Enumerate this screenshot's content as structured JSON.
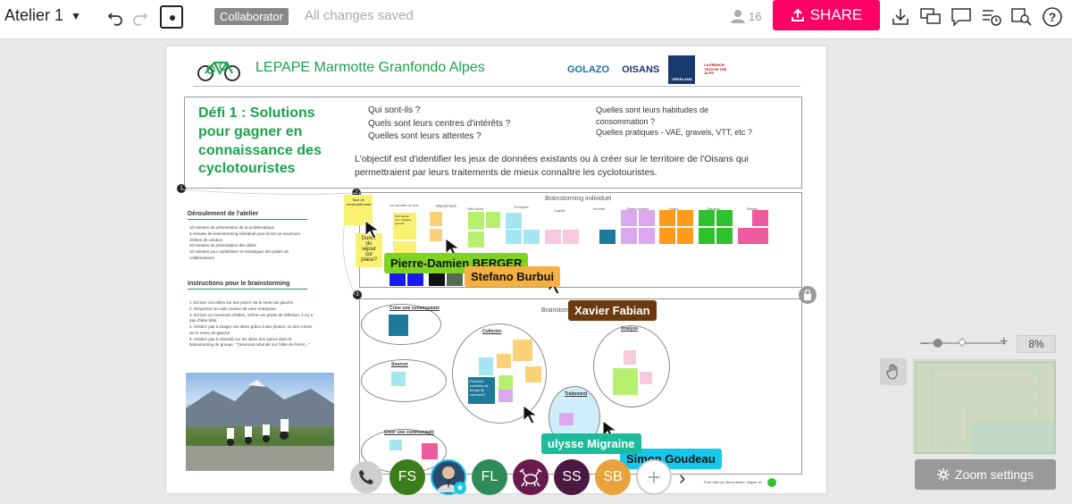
{
  "toolbar": {
    "board_title": "Atelier 1",
    "role_badge": "Collaborator",
    "save_status": "All changes saved",
    "participant_count": "16",
    "share_label": "SHARE",
    "share_color": "#ff0066"
  },
  "board": {
    "header_title": "LEPAPE Marmotte Granfondo Alpes",
    "logos": [
      "GOLAZO",
      "OISANS",
      "OBERLAND",
      "La FRENCH TECH IN THE ALPS"
    ],
    "defi": {
      "title": "Défi 1 : Solutions pour gagner en connaissance des cyclotouristes",
      "questions_left": [
        "Qui sont-ils ?",
        "Quels sont leurs centres d'intérêts ?",
        "Quelles sont leurs attentes ?"
      ],
      "questions_right": [
        "Quelles sont leurs habitudes de consommation ?",
        "Quelles pratiques - VAE, gravels, VTT, etc ?"
      ],
      "objective": "L'objectif est d'identifier les jeux de données existants ou à créer sur le territoire de l'Oisans qui permettraient par leurs traitements de mieux connaître les cyclotouristes."
    },
    "left_panel": {
      "deroulement_title": "Déroulement de l'atelier",
      "deroulement_lines": [
        "10 minutes de présentation de la problématique",
        "3 minutes de brainstorming individuel pour écrire un maximum d'idées de solution",
        "20 minutes de présentation des idées",
        "10 minutes pour synthétiser et investiguer des pistes de collaborations"
      ],
      "instructions_title": "Instructions pour le brainstorming",
      "instructions_lines": [
        "1. Ecrivez vos idées sur des post-it via le menu de gauche",
        "2. Respectez le code couleur de votre entreprise",
        "3. Ecrivez un maximum d'idées, même vos pistes de réflexion, il n'y a pas d'idée bête",
        "4. Hésitez pas à imager vos idées grâce à des photos, ou des icônes via le menu de gauche",
        "5. Hésitez pas à rebondir sur les idées des autres dans le brainstorming de groupe : \"j'aimerais rebondir sur l'idée de Pierre...\""
      ]
    },
    "steps": [
      "1",
      "2",
      "3"
    ],
    "brainstorm_individual_title": "Brainstorming individuel",
    "brainstorm_group_title": "Brainstorming",
    "column_labels": [
      "Les données de tous",
      "Marvel lock",
      "Vitis Epona",
      "Tunnpark",
      "Cognitiv",
      "Mountek",
      "Oisans tourisme",
      "Golazo",
      "Oberland",
      "Wingtip"
    ],
    "sticky_texts": {
      "taux": "Taux de renouvellement",
      "duree": "Durée du séjour sur place?",
      "tarif": "Tarif spécial pour cyclistes groupés",
      "pendant": "Pendant combien de temps ils viennent?"
    },
    "ellipses": {
      "creer1": "Créer une communauté",
      "sourcer": "Sourcer",
      "creer2": "Créer une communauté",
      "collecter": "Collecter",
      "analyse": "Analyse",
      "traitement": "Traitement"
    },
    "footer_note": "Pour aller au 3ème atelier, cliquer ici"
  },
  "cursors": [
    {
      "name": "Pierre-Damien BERGER",
      "color": "#7ed321"
    },
    {
      "name": "Stefano Burbui",
      "color": "#f5b041"
    },
    {
      "name": "Xavier Fabian",
      "color": "#6b3a10"
    },
    {
      "name": "ulysse Migraine",
      "color": "#1abc9c"
    },
    {
      "name": "Simon Goudeau",
      "color": "#15c8ea"
    }
  ],
  "avatars": [
    {
      "label": "FS",
      "color": "#3a7d1a"
    },
    {
      "label": "",
      "color": "#2b4a6f"
    },
    {
      "label": "FL",
      "color": "#2e8b57"
    },
    {
      "label": "",
      "color": "#6a1b4d"
    },
    {
      "label": "SS",
      "color": "#4a1942"
    },
    {
      "label": "SB",
      "color": "#e8a33c"
    }
  ],
  "zoom": {
    "percent": "8%",
    "settings_label": "Zoom settings",
    "level": 0.3
  }
}
